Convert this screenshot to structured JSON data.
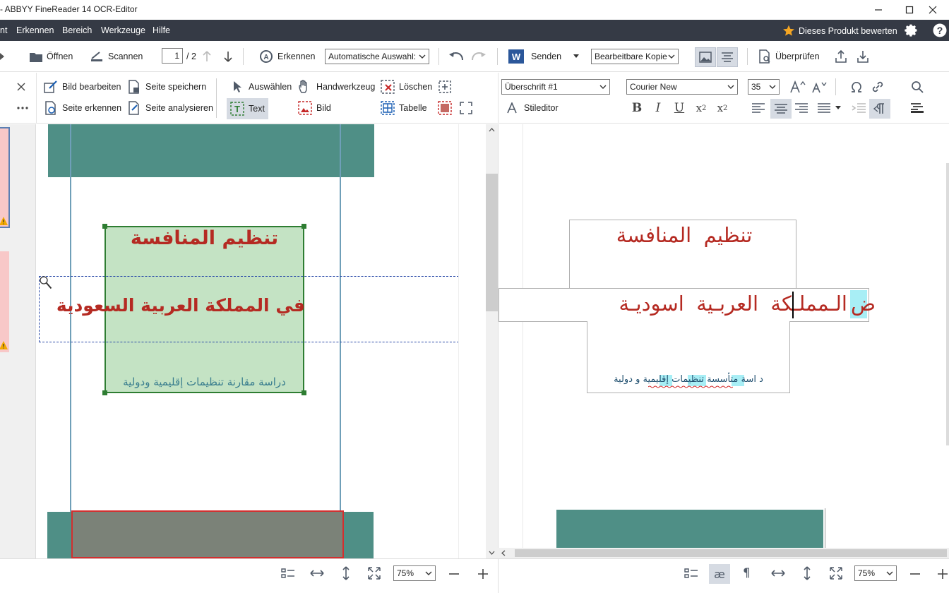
{
  "window": {
    "title": "- ABBYY FineReader 14 OCR-Editor"
  },
  "menu": {
    "items": [
      "nt",
      "Erkennen",
      "Bereich",
      "Werkzeuge",
      "Hilfe"
    ],
    "rate": "Dieses Produkt bewerten"
  },
  "toolbar": {
    "open": "Öffnen",
    "scan": "Scannen",
    "page_current": "1",
    "page_total": "/ 2",
    "recognize": "Erkennen",
    "language": "Automatische Auswahl:",
    "send": "Senden",
    "mode": "Bearbeitbare Kopie",
    "verify": "Überprüfen"
  },
  "image_tools": {
    "edit_image": "Bild bearbeiten",
    "save_page": "Seite speichern",
    "recognize_page": "Seite erkennen",
    "analyze_page": "Seite analysieren",
    "select": "Auswählen",
    "hand": "Handwerkzeug",
    "delete": "Löschen",
    "text": "Text",
    "picture": "Bild",
    "table": "Tabelle"
  },
  "text_tools": {
    "style": "Überschrift #1",
    "font": "Courier New",
    "size": "35",
    "style_editor": "Stileditor"
  },
  "image_page": {
    "title_line1": "تنظيم المنافسة",
    "title_line2": "في المملكة العربية السعودية",
    "subtitle": "دراسة مقارنة تنظيمات إقليمية ودولية"
  },
  "text_page": {
    "line1": "تنظيم المنافسة",
    "line2_prefix": "ض",
    "line2_rest": "الـمملـكة العربـية اسوديـة",
    "line3": "د اسة متأسسة تنظيمات إقليمية و دولية"
  },
  "status": {
    "zoom_left": "75%",
    "zoom_right": "75%"
  },
  "colors": {
    "menubar": "#353a45",
    "accent_blue": "#1a5fb4",
    "title_red": "#b52a22",
    "teal": "#4f8f86",
    "selection_green": "#c8e6c9"
  }
}
